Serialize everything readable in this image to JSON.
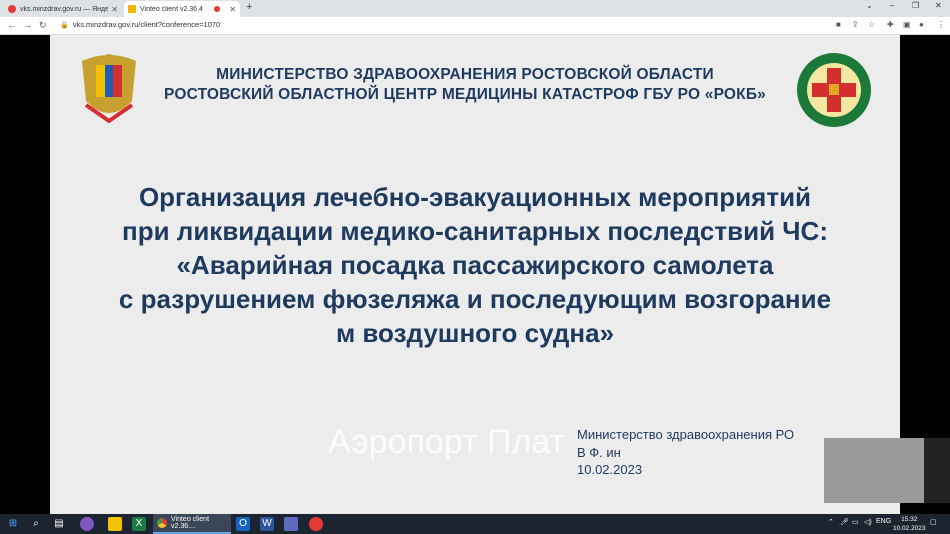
{
  "browser": {
    "tabs": [
      {
        "title": "vks.minzdrav.gov.ru — Яндекс: н"
      },
      {
        "title": "Vinteo client v2.36.4"
      }
    ],
    "new_tab": "+",
    "url": "vks.minzdrav.gov.ru/client?conference=1070",
    "lock_glyph": "🔒",
    "win_controls": {
      "dropdown": "⌄",
      "minimize": "–",
      "restore": "❐",
      "close": "✕"
    }
  },
  "slide": {
    "header_line1": "МИНИСТЕРСТВО ЗДРАВООХРАНЕНИЯ РОСТОВСКОЙ ОБЛАСТИ",
    "header_line2": "РОСТОВСКИЙ ОБЛАСТНОЙ ЦЕНТР МЕДИЦИНЫ КАТАСТРОФ ГБУ РО «РОКБ»",
    "title_lines": [
      "Организация лечебно-эвакуационных мероприятий",
      "при ликвидации медико-санитарных последствий ЧС:",
      "«Аварийная посадка пассажирского самолета",
      "с разрушением фюзеляжа и последующим возгорание",
      "м воздушного судна»"
    ],
    "overlay_caption": "Аэропорт Плат",
    "meta_line1": "Министерство здравоохранения РО",
    "meta_line2": "В Ф. ин",
    "meta_date": "10.02.2023"
  },
  "taskbar": {
    "active_app": "Vinteo client v2.36....",
    "lang": "ENG",
    "time": "15:32",
    "date": "10.02.2023"
  },
  "colors": {
    "heading": "#1f3a5f",
    "slide_bg": "#ececec",
    "taskbar_bg": "#1c2430"
  }
}
